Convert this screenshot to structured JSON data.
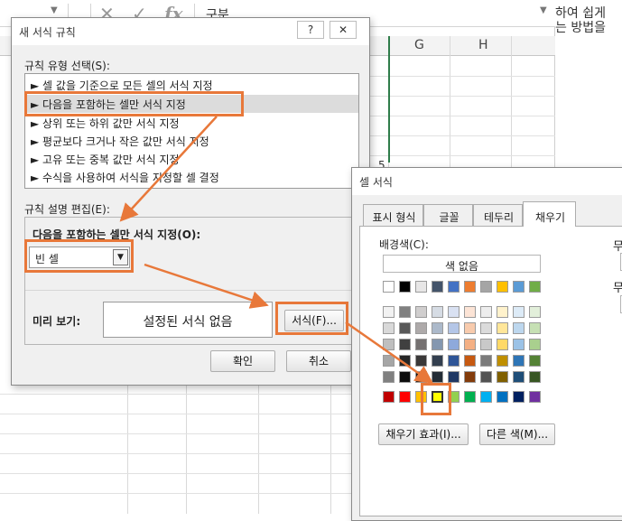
{
  "excel": {
    "formula_value": "구분",
    "columns": [
      "G",
      "H"
    ],
    "cell_value": "5"
  },
  "right_doc": {
    "lines": [
      "하여 쉽게",
      "는 방법을"
    ],
    "frag1": "무",
    "frag2": "무"
  },
  "rule_dialog": {
    "title": "새 서식 규칙",
    "help": "?",
    "close": "✕",
    "type_label": "규칙 유형 선택(S):",
    "rule_types": [
      "► 셀 값을 기준으로 모든 셀의 서식 지정",
      "► 다음을 포함하는 셀만 서식 지정",
      "► 상위 또는 하위 값만 서식 지정",
      "► 평균보다 크거나 작은 값만 서식 지정",
      "► 고유 또는 중복 값만 서식 지정",
      "► 수식을 사용하여 서식을 지정할 셀 결정"
    ],
    "edit_label": "규칙 설명 편집(E):",
    "edit_heading": "다음을 포함하는 셀만 서식 지정(O):",
    "combo_value": "빈 셀",
    "preview_label": "미리 보기:",
    "preview_text": "설정된 서식 없음",
    "format_button": "서식(F)...",
    "ok_button": "확인",
    "cancel_button": "취소"
  },
  "cell_dialog": {
    "title": "셀 서식",
    "tabs": [
      "표시 형식",
      "글꼴",
      "테두리",
      "채우기"
    ],
    "bg_label": "배경색(C):",
    "no_color": "색 없음",
    "fill_effects": "채우기 효과(I)...",
    "more_colors": "다른 색(M)..."
  },
  "palette": {
    "top_row": [
      "#ffffff",
      "#000000",
      "#e7e6e6",
      "#44546a",
      "#4472c4",
      "#ed7d31",
      "#a5a5a5",
      "#ffc000",
      "#5b9bd5",
      "#70ad47"
    ],
    "theme_rows": [
      [
        "#f2f2f2",
        "#808080",
        "#d0cece",
        "#d6dce4",
        "#d9e1f2",
        "#fce4d6",
        "#ededed",
        "#fff2cc",
        "#ddebf7",
        "#e2efda"
      ],
      [
        "#d9d9d9",
        "#595959",
        "#aeaaaa",
        "#acb9ca",
        "#b4c6e7",
        "#f8cbad",
        "#dbdbdb",
        "#ffe699",
        "#bdd7ee",
        "#c6e0b4"
      ],
      [
        "#bfbfbf",
        "#404040",
        "#757171",
        "#8497b0",
        "#8ea9db",
        "#f4b084",
        "#c9c9c9",
        "#ffd966",
        "#9bc2e6",
        "#a9d08e"
      ],
      [
        "#a6a6a6",
        "#262626",
        "#3a3838",
        "#333f4f",
        "#2f5597",
        "#c65911",
        "#7b7b7b",
        "#bf8f00",
        "#2e75b6",
        "#548235"
      ],
      [
        "#808080",
        "#0d0d0d",
        "#161616",
        "#222b35",
        "#1f3864",
        "#833c0b",
        "#525252",
        "#806000",
        "#1f4e78",
        "#375623"
      ]
    ],
    "standard_row": [
      "#c00000",
      "#ff0000",
      "#ffc000",
      "#ffff00",
      "#92d050",
      "#00b050",
      "#00b0f0",
      "#0070c0",
      "#002060",
      "#7030a0"
    ],
    "selected_color": "#ffff00"
  },
  "accent": "#e8783a"
}
